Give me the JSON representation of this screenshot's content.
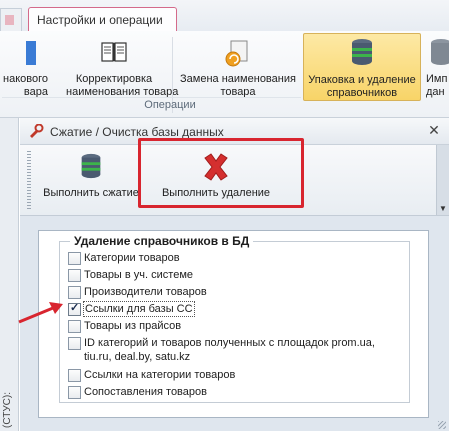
{
  "ribbon": {
    "tabs": [
      {
        "label": ""
      },
      {
        "label": "Настройки и операции"
      }
    ],
    "buttons": [
      {
        "label_line1": "накового",
        "label_line2": "вара"
      },
      {
        "label_line1": "Корректировка",
        "label_line2": "наименования товара"
      },
      {
        "label_line1": "Замена наименования",
        "label_line2": "товара"
      },
      {
        "label_line1": "Упаковка и удаление",
        "label_line2": "справочников"
      },
      {
        "label_line1": "Имп",
        "label_line2": "дан"
      }
    ],
    "group_label": "Операции"
  },
  "left_strip": {
    "status_text": "(СТУС):"
  },
  "window": {
    "title": "Сжатие / Очистка базы данных",
    "toolbar": {
      "compress_label": "Выполнить сжатие",
      "delete_label": "Выполнить удаление"
    },
    "group_title": "Удаление справочников в БД",
    "items": [
      {
        "label": "Категории товаров",
        "checked": false
      },
      {
        "label": "Товары в уч. системе",
        "checked": false
      },
      {
        "label": "Производители товаров",
        "checked": false
      },
      {
        "label": "Ссылки для базы СС",
        "checked": true
      },
      {
        "label": "Товары из прайсов",
        "checked": false
      },
      {
        "label_line1": "ID категорий и товаров полученных с площадок prom.ua,",
        "label_line2": "tiu.ru, deal.by, satu.kz",
        "checked": false
      },
      {
        "label": "Ссылки на категории товаров",
        "checked": false
      },
      {
        "label": "Сопоставления товаров",
        "checked": false
      }
    ]
  },
  "colors": {
    "highlight": "#d8252f",
    "active_button": "#f8d468"
  }
}
